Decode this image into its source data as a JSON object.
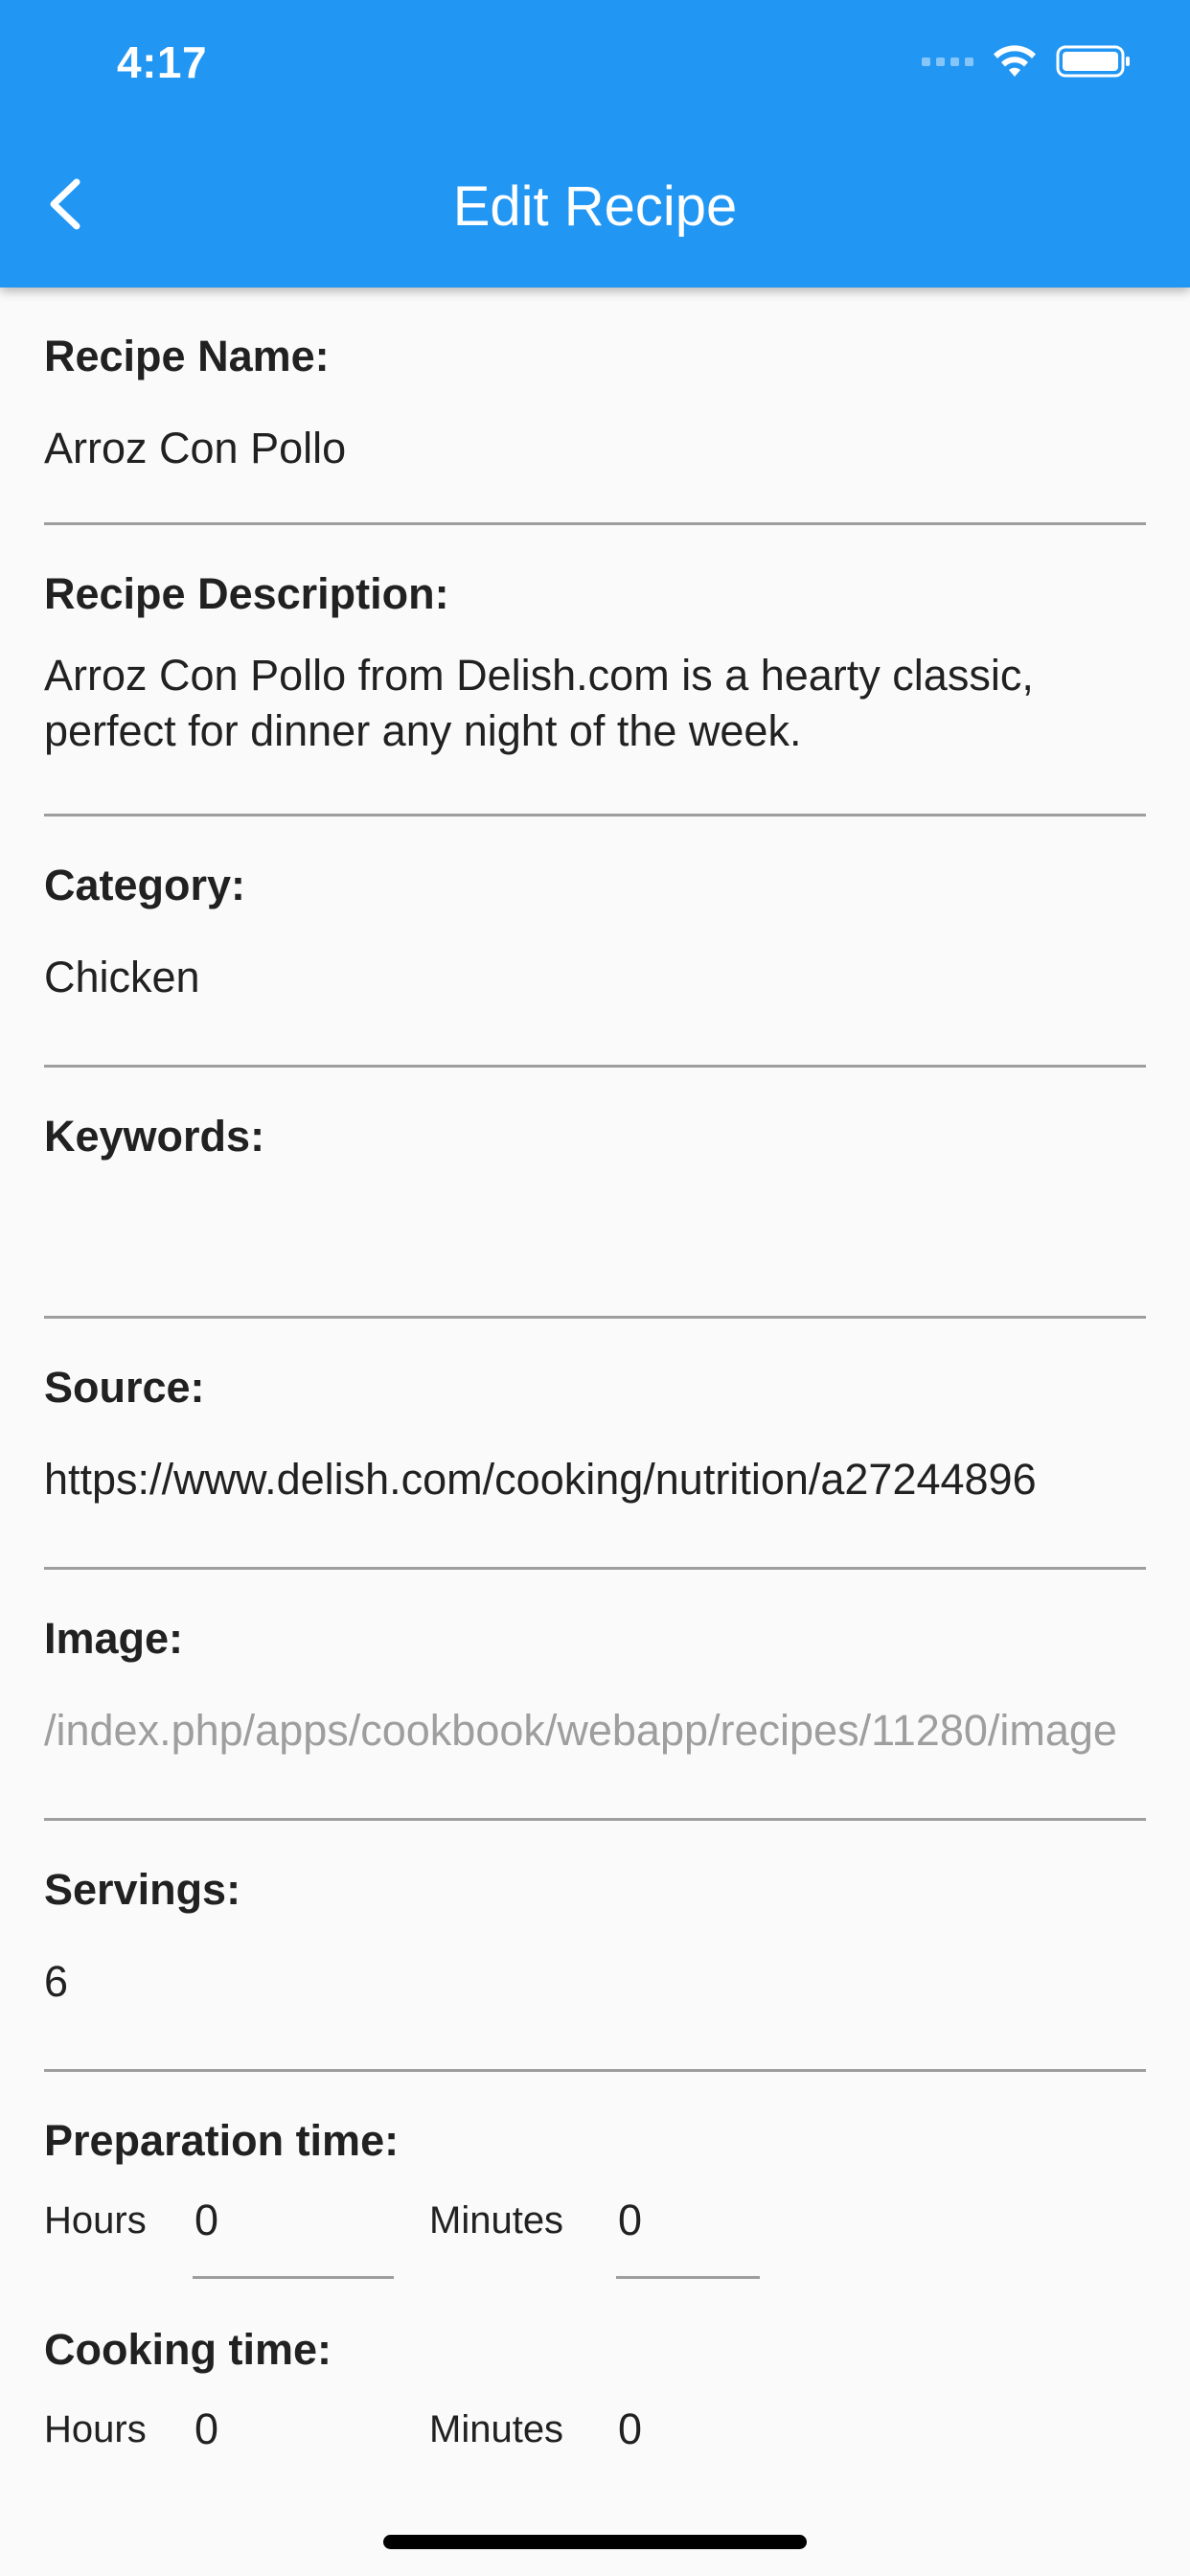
{
  "status_bar": {
    "time": "4:17"
  },
  "app_bar": {
    "title": "Edit Recipe",
    "background": "#2196f3"
  },
  "fields": {
    "name": {
      "label": "Recipe Name:",
      "value": "Arroz Con Pollo"
    },
    "description": {
      "label": "Recipe Description:",
      "value": "Arroz Con Pollo from Delish.com is a hearty classic, perfect for dinner any night of the week."
    },
    "category": {
      "label": "Category:",
      "value": "Chicken"
    },
    "keywords": {
      "label": "Keywords:",
      "value": ""
    },
    "source": {
      "label": "Source:",
      "value": "https://www.delish.com/cooking/nutrition/a27244896"
    },
    "image": {
      "label": "Image:",
      "value": "/index.php/apps/cookbook/webapp/recipes/11280/image"
    },
    "servings": {
      "label": "Servings:",
      "value": "6"
    }
  },
  "prep_time": {
    "label": "Preparation time:",
    "hours_label": "Hours",
    "hours_value": "0",
    "minutes_label": "Minutes",
    "minutes_value": "0"
  },
  "cook_time": {
    "label": "Cooking time:",
    "hours_label": "Hours",
    "hours_value": "0",
    "minutes_label": "Minutes",
    "minutes_value": "0"
  },
  "icons": {
    "back": "chevron-left-icon",
    "wifi": "wifi-icon",
    "battery": "battery-icon",
    "signal": "signal-icon"
  }
}
